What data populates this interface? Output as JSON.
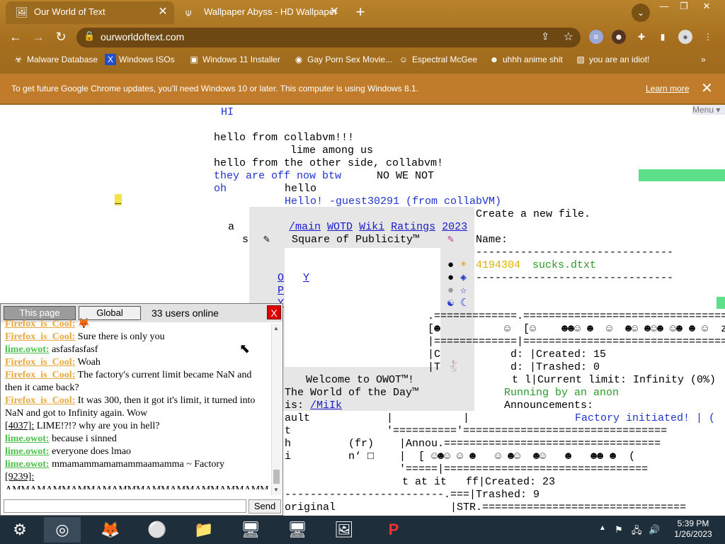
{
  "browser": {
    "tabs": [
      {
        "title": "Our World of Text",
        "icon": "🖼"
      },
      {
        "title": "Wallpaper Abyss - HD Wallpaper",
        "icon": "⍦"
      }
    ],
    "new_tab": "+",
    "window_buttons": [
      "—",
      "❐",
      "✕"
    ],
    "tab_menu": "⌄",
    "nav": {
      "back": "←",
      "forward": "→",
      "reload": "↻"
    },
    "url": "ourworldoftext.com",
    "bookmarks": [
      {
        "label": "Malware Database",
        "icon": "☣"
      },
      {
        "label": "Windows ISOs",
        "icon": "X"
      },
      {
        "label": "Windows 11 Installer",
        "icon": "▣"
      },
      {
        "label": "Gay Porn Sex Movie...",
        "icon": "◉"
      },
      {
        "label": "Espectral McGee",
        "icon": "☺"
      },
      {
        "label": "uhhh anime shit",
        "icon": "☻"
      },
      {
        "label": "you are an idiot!",
        "icon": "▧"
      }
    ],
    "bookmarks_more": "»",
    "infobar": {
      "message": "To get future Google Chrome updates, you'll need Windows 10 or later. This computer is using Windows 8.1.",
      "learn_more": "Learn more",
      "close": "✕"
    }
  },
  "page": {
    "menu": "Menu ▾",
    "hi": "HI",
    "lines": [
      "hello from collabvm!!!",
      "            lime among us",
      "hello from the other side, collabvm!"
    ],
    "blue_line1": "they are off now btw",
    "black_line1": "NO WE NOT",
    "blue_line2": "oh",
    "black_line2": "hello",
    "blue_line3": "Hello! -guest30291 (from collabVM)",
    "cursor": "_",
    "panel": {
      "links": [
        "/main",
        "WOTD",
        "Wiki",
        "Ratings",
        "2023"
      ],
      "create": "Create a new file.",
      "square": "Square of Publicity™",
      "name_label": "Name:",
      "dashes": "-------------------------------",
      "file_id": "4194304",
      "file_name": "sucks.dtxt",
      "side_letters": [
        "Y",
        "O",
        "P",
        "Y"
      ],
      "welcome": "Welcome to OWOT™!",
      "wotd": "The World of the Day™",
      "is_label": "is:",
      "wotd_link": "/MiIk",
      "a": "a",
      "s": "s"
    },
    "right_lines": [
      ".=============.================================",
      "[☻          ☺  [☺    ☻☻☺ ☻  ☺  ☻☺ ☻☺☻ ☺☻ ☻ ☺  z",
      "|=============|================================",
      "|C           d: |Created: 15",
      "|T           d: |Trashed: 0",
      "           t l|Current limit: Infinity (0%)"
    ],
    "running": "Running by an anon",
    "announcements": "Announcements:",
    "factory": "Factory initiated! | (",
    "lower_lines": [
      "ault            |           |",
      "t               '=========='================================",
      "h         (fr)    |Annou.==================================",
      "i         n‘ □    |  [ ☺☻☺ ☺ ☻   ☺ ☻☺  ☻☺   ☻   ☻☻ ☻  (",
      "                  '=====|================================",
      "              t at it   ff|Created: 23",
      "-------------------------.===|Trashed: 9",
      "original                  |STR.================================"
    ]
  },
  "chat": {
    "tab_this": "This page",
    "tab_global": "Global",
    "online": "33 users online",
    "close": "X",
    "messages": [
      {
        "nick": "Firefox_is_Cool:",
        "text": " 🦊",
        "color": "#e8a840"
      },
      {
        "nick": "Firefox_is_Cool:",
        "text": " Sure there is only you",
        "color": "#e8a840"
      },
      {
        "nick": "lime.owot:",
        "text": " asfasfasfasf",
        "color": "#4cc24c"
      },
      {
        "nick": "Firefox_is_Cool:",
        "text": " Woah",
        "color": "#e8a840"
      },
      {
        "nick": "Firefox_is_Cool:",
        "text": " The factory's current limit became NaN and then it came back?",
        "color": "#e8a840"
      },
      {
        "nick": "Firefox_is_Cool:",
        "text": " It was 300, then it got it's limit, it turned into NaN and got to Infinity again. Wow",
        "color": "#e8a840"
      },
      {
        "nick": "[4037]:",
        "text": " LIME!?!? why are you in hell?",
        "color": "#000000"
      },
      {
        "nick": "lime.owot:",
        "text": " because i sinned",
        "color": "#4cc24c"
      },
      {
        "nick": "lime.owot:",
        "text": " everyone does lmao",
        "color": "#4cc24c"
      },
      {
        "nick": "lime.owot:",
        "text": " mmamammamamammaamamma ~ Factory",
        "color": "#4cc24c"
      },
      {
        "nick": "[9239]:",
        "text": " AMMAMAMMAMMAMAMMMAMMAMMAMMAMMAMM",
        "color": "#000000"
      }
    ],
    "send": "Send"
  },
  "taskbar": {
    "apps": [
      "⚙",
      "◎",
      "🦊",
      "⚪",
      "📁",
      "🖥",
      "🖥",
      "🖼",
      "P"
    ],
    "tray": [
      "▲",
      "⚑",
      "🖧",
      "🔊"
    ],
    "time": "5:39 PM",
    "date": "1/26/2023"
  }
}
